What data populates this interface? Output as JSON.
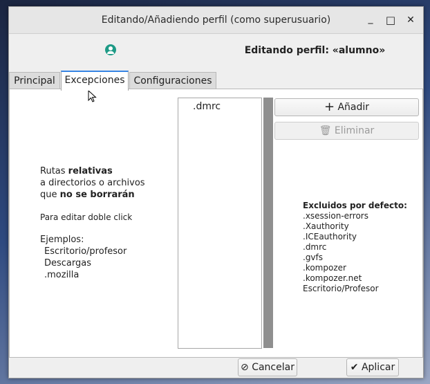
{
  "window": {
    "title": "Editando/Añadiendo perfil (como superusuario)",
    "minimize": "_",
    "maximize": "□",
    "close": "✕"
  },
  "header": {
    "title": "Editando perfil: «alumno»",
    "icon": "user-account-icon"
  },
  "tabs": [
    {
      "label": "Principal"
    },
    {
      "label": "Excepciones"
    },
    {
      "label": "Configuraciones"
    }
  ],
  "info": {
    "l1_a": "Rutas ",
    "l1_b": "relativas",
    "l2": "a directorios o archivos",
    "l3_a": "que ",
    "l3_b": "no se borrarán",
    "hint": "Para editar doble click",
    "examples_title": "Ejemplos:",
    "examples": [
      "Escritorio/profesor",
      "Descargas",
      ".mozilla"
    ]
  },
  "list": {
    "items": [
      ".dmrc"
    ]
  },
  "buttons": {
    "add": "Añadir",
    "remove": "Eliminar",
    "cancel": "Cancelar",
    "apply": "Aplicar"
  },
  "defaults": {
    "title": "Excluidos por defecto:",
    "items": [
      ".xsession-errors",
      ".Xauthority",
      ".ICEauthority",
      ".dmrc",
      ".gvfs",
      ".kompozer",
      ".kompozer.net",
      "Escritorio/Profesor"
    ]
  }
}
